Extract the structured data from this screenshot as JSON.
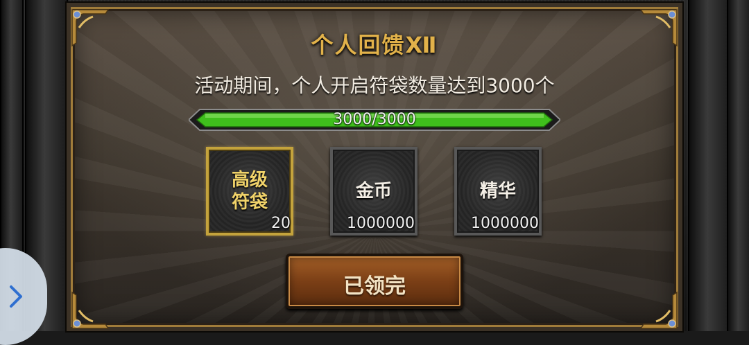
{
  "panel": {
    "title": "个人回馈Ⅻ",
    "description": "活动期间，个人开启符袋数量达到3000个"
  },
  "progress": {
    "text": "3000/3000",
    "current": 3000,
    "total": 3000,
    "fill_fraction": 1.0,
    "fill_color": "#3fbf1c"
  },
  "rewards": [
    {
      "name_line1": "高级",
      "name_line2": "符袋",
      "count": "20",
      "highlighted": true,
      "border_color": "#c4a33c"
    },
    {
      "name_line1": "金币",
      "name_line2": "",
      "count": "1000000",
      "highlighted": false,
      "border_color": "#585858"
    },
    {
      "name_line1": "精华",
      "name_line2": "",
      "count": "1000000",
      "highlighted": false,
      "border_color": "#585858"
    }
  ],
  "claim_button": {
    "label": "已领完",
    "state": "claimed"
  },
  "side_handle": {
    "icon": "chevron-right-icon"
  },
  "colors": {
    "title": "#e2b24a",
    "accent_gold": "#a07c3a",
    "button": "#7b3f16"
  }
}
